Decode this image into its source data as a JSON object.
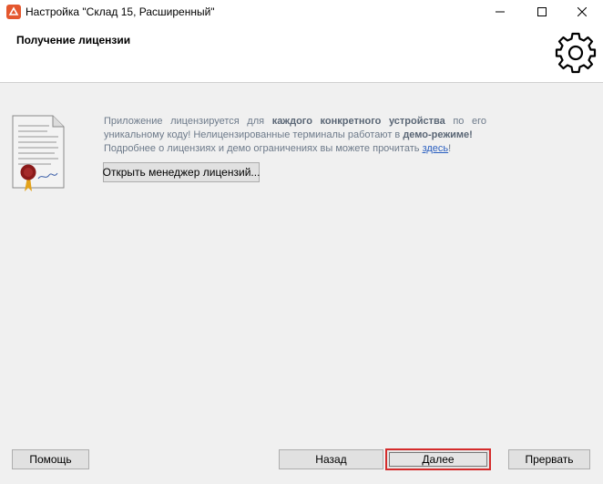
{
  "window": {
    "title": "Настройка \"Склад 15, Расширенный\"",
    "icons": [
      "app-icon",
      "minimize-icon",
      "maximize-icon",
      "close-icon"
    ]
  },
  "header": {
    "title": "Получение лицензии",
    "icon": "gear-icon"
  },
  "info": {
    "text_1": "Приложение лицензируется для ",
    "emph_1": "каждого конкретного устройства",
    "text_2": " по его уникальному коду! Нелицензированные терминалы работают в ",
    "emph_2": "демо-режиме!",
    "text_3": "Подробнее о лицензиях и демо ограничениях вы можете прочитать ",
    "link": "здесь",
    "text_4": "!",
    "icon": "certificate-icon"
  },
  "buttons": {
    "license_manager": "Открыть менеджер лицензий...",
    "help": "Помощь",
    "back": "Назад",
    "next": "Далее",
    "cancel": "Прервать"
  },
  "colors": {
    "highlight_border": "#d42b2b",
    "info_text": "#6d7a8a",
    "link": "#2a5fc0"
  }
}
